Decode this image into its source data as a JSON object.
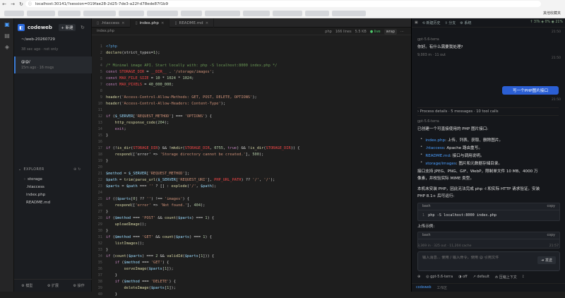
{
  "browser": {
    "url": "localhost:30141/?session=019fae28-2d25-7de3-a22f-d78ede87f1b9",
    "other_bookmarks": "其他收藏夹"
  },
  "sidebar": {
    "brand": "codeweb",
    "new_label": "+ 新建",
    "workspace": "~/web-20260729",
    "workspace_sub": "38 sec ago · not only",
    "session": {
      "title": "@@/",
      "meta": "15m ago · 16 msgs"
    },
    "explorer_title": "EXPLORER",
    "tree": [
      {
        "name": "storage",
        "type": "folder"
      },
      {
        "name": ".htaccess",
        "type": "file"
      },
      {
        "name": "index.php",
        "type": "file"
      },
      {
        "name": "README.md",
        "type": "file"
      }
    ],
    "footer": [
      "⚙ 模型",
      "⚙ 扩展",
      "⚙ 操作"
    ]
  },
  "editor": {
    "tabs": [
      {
        "label": ".htaccess",
        "active": false
      },
      {
        "label": "index.php",
        "active": true
      },
      {
        "label": "README.md",
        "active": false
      }
    ],
    "path": "index.php",
    "lang": "php",
    "lines_count": "166 lines",
    "size": "5.5 KB",
    "live": "● live",
    "wrap": "wrap"
  },
  "code": [
    [
      [
        "tg",
        "<?php"
      ]
    ],
    [
      [
        "fn",
        "declare"
      ],
      [
        "pl",
        "(strict_types="
      ],
      [
        "nm",
        "1"
      ],
      [
        "pl",
        ");"
      ]
    ],
    [],
    [
      [
        "cm",
        "/* Minimal image API. Start locally with: php -S localhost:8000 index.php */"
      ]
    ],
    [
      [
        "kw",
        "const "
      ],
      [
        "cst",
        "STORAGE_DIR"
      ],
      [
        "pl",
        " = "
      ],
      [
        "cst",
        "__DIR__"
      ],
      [
        "pl",
        " . "
      ],
      [
        "str",
        "'/storage/images'"
      ],
      [
        "pl",
        ";"
      ]
    ],
    [
      [
        "kw",
        "const "
      ],
      [
        "cst",
        "MAX_FILE_SIZE"
      ],
      [
        "pl",
        " = "
      ],
      [
        "nm",
        "10"
      ],
      [
        "pl",
        " * "
      ],
      [
        "nm",
        "1024"
      ],
      [
        "pl",
        " * "
      ],
      [
        "nm",
        "1024"
      ],
      [
        "pl",
        ";"
      ]
    ],
    [
      [
        "kw",
        "const "
      ],
      [
        "cst",
        "MAX_PIXELS"
      ],
      [
        "pl",
        " = "
      ],
      [
        "nm",
        "40_000_000"
      ],
      [
        "pl",
        ";"
      ]
    ],
    [],
    [
      [
        "fn",
        "header"
      ],
      [
        "pl",
        "("
      ],
      [
        "str",
        "'Access-Control-Allow-Methods: GET, POST, DELETE, OPTIONS'"
      ],
      [
        "pl",
        ");"
      ]
    ],
    [
      [
        "fn",
        "header"
      ],
      [
        "pl",
        "("
      ],
      [
        "str",
        "'Access-Control-Allow-Headers: Content-Type'"
      ],
      [
        "pl",
        ");"
      ]
    ],
    [],
    [
      [
        "kw",
        "if"
      ],
      [
        "pl",
        " ("
      ],
      [
        "var",
        "$_SERVER"
      ],
      [
        "pl",
        "["
      ],
      [
        "str",
        "'REQUEST_METHOD'"
      ],
      [
        "pl",
        "] === "
      ],
      [
        "str",
        "'OPTIONS'"
      ],
      [
        "pl",
        ") {"
      ]
    ],
    [
      [
        "pl",
        "    "
      ],
      [
        "fn",
        "http_response_code"
      ],
      [
        "pl",
        "("
      ],
      [
        "nm",
        "204"
      ],
      [
        "pl",
        ");"
      ]
    ],
    [
      [
        "pl",
        "    "
      ],
      [
        "kw",
        "exit"
      ],
      [
        "pl",
        ";"
      ]
    ],
    [
      [
        "pl",
        "}"
      ]
    ],
    [],
    [
      [
        "kw",
        "if"
      ],
      [
        "pl",
        " (!"
      ],
      [
        "fn",
        "is_dir"
      ],
      [
        "pl",
        "("
      ],
      [
        "cst",
        "STORAGE_DIR"
      ],
      [
        "pl",
        ") && !"
      ],
      [
        "fn",
        "mkdir"
      ],
      [
        "pl",
        "("
      ],
      [
        "cst",
        "STORAGE_DIR"
      ],
      [
        "pl",
        ", "
      ],
      [
        "nm",
        "0755"
      ],
      [
        "pl",
        ", "
      ],
      [
        "kw",
        "true"
      ],
      [
        "pl",
        ") && !"
      ],
      [
        "fn",
        "is_dir"
      ],
      [
        "pl",
        "("
      ],
      [
        "cst",
        "STORAGE_DIR"
      ],
      [
        "pl",
        ")) {"
      ]
    ],
    [
      [
        "pl",
        "    "
      ],
      [
        "fn",
        "respond"
      ],
      [
        "pl",
        "(['error' => "
      ],
      [
        "str",
        "'Storage directory cannot be created.'"
      ],
      [
        "pl",
        "], "
      ],
      [
        "nm",
        "500"
      ],
      [
        "pl",
        ");"
      ]
    ],
    [
      [
        "pl",
        "}"
      ]
    ],
    [],
    [
      [
        "var",
        "$method"
      ],
      [
        "pl",
        " = "
      ],
      [
        "var",
        "$_SERVER"
      ],
      [
        "pl",
        "["
      ],
      [
        "str",
        "'REQUEST_METHOD'"
      ],
      [
        "pl",
        "];"
      ]
    ],
    [
      [
        "var",
        "$path"
      ],
      [
        "pl",
        " = "
      ],
      [
        "fn",
        "trim"
      ],
      [
        "pl",
        "("
      ],
      [
        "fn",
        "parse_url"
      ],
      [
        "pl",
        "("
      ],
      [
        "var",
        "$_SERVER"
      ],
      [
        "pl",
        "["
      ],
      [
        "str",
        "'REQUEST_URI'"
      ],
      [
        "pl",
        "], "
      ],
      [
        "cst",
        "PHP_URL_PATH"
      ],
      [
        "pl",
        ") ?? "
      ],
      [
        "str",
        "'/'"
      ],
      [
        "pl",
        ", "
      ],
      [
        "str",
        "'/'"
      ],
      [
        "pl",
        ");"
      ]
    ],
    [
      [
        "var",
        "$parts"
      ],
      [
        "pl",
        " = "
      ],
      [
        "var",
        "$path"
      ],
      [
        "pl",
        " === "
      ],
      [
        "str",
        "''"
      ],
      [
        "pl",
        " ? [] : "
      ],
      [
        "fn",
        "explode"
      ],
      [
        "pl",
        "("
      ],
      [
        "str",
        "'/'"
      ],
      [
        "pl",
        ", "
      ],
      [
        "var",
        "$path"
      ],
      [
        "pl",
        ");"
      ]
    ],
    [],
    [
      [
        "kw",
        "if"
      ],
      [
        "pl",
        " (("
      ],
      [
        "var",
        "$parts"
      ],
      [
        "pl",
        "["
      ],
      [
        "nm",
        "0"
      ],
      [
        "pl",
        "] ?? "
      ],
      [
        "str",
        "''"
      ],
      [
        "pl",
        ") !== "
      ],
      [
        "str",
        "'images'"
      ],
      [
        "pl",
        ") {"
      ]
    ],
    [
      [
        "pl",
        "    "
      ],
      [
        "fn",
        "respond"
      ],
      [
        "pl",
        "(["
      ],
      [
        "str",
        "'error'"
      ],
      [
        "pl",
        " => "
      ],
      [
        "str",
        "'Not found.'"
      ],
      [
        "pl",
        "], "
      ],
      [
        "nm",
        "404"
      ],
      [
        "pl",
        ");"
      ]
    ],
    [
      [
        "pl",
        "}"
      ]
    ],
    [
      [
        "kw",
        "if"
      ],
      [
        "pl",
        " ("
      ],
      [
        "var",
        "$method"
      ],
      [
        "pl",
        " === "
      ],
      [
        "str",
        "'POST'"
      ],
      [
        "pl",
        " && "
      ],
      [
        "fn",
        "count"
      ],
      [
        "pl",
        "("
      ],
      [
        "var",
        "$parts"
      ],
      [
        "pl",
        ") === "
      ],
      [
        "nm",
        "1"
      ],
      [
        "pl",
        ") {"
      ]
    ],
    [
      [
        "pl",
        "    "
      ],
      [
        "fn",
        "uploadImage"
      ],
      [
        "pl",
        "();"
      ]
    ],
    [
      [
        "pl",
        "}"
      ]
    ],
    [
      [
        "kw",
        "if"
      ],
      [
        "pl",
        " ("
      ],
      [
        "var",
        "$method"
      ],
      [
        "pl",
        " === "
      ],
      [
        "str",
        "'GET'"
      ],
      [
        "pl",
        " && "
      ],
      [
        "fn",
        "count"
      ],
      [
        "pl",
        "("
      ],
      [
        "var",
        "$parts"
      ],
      [
        "pl",
        ") === "
      ],
      [
        "nm",
        "1"
      ],
      [
        "pl",
        ") {"
      ]
    ],
    [
      [
        "pl",
        "    "
      ],
      [
        "fn",
        "listImages"
      ],
      [
        "pl",
        "();"
      ]
    ],
    [
      [
        "pl",
        "}"
      ]
    ],
    [
      [
        "kw",
        "if"
      ],
      [
        "pl",
        " ("
      ],
      [
        "fn",
        "count"
      ],
      [
        "pl",
        "("
      ],
      [
        "var",
        "$parts"
      ],
      [
        "pl",
        ") === "
      ],
      [
        "nm",
        "2"
      ],
      [
        "pl",
        " && "
      ],
      [
        "fn",
        "validId"
      ],
      [
        "pl",
        "("
      ],
      [
        "var",
        "$parts"
      ],
      [
        "pl",
        "["
      ],
      [
        "nm",
        "1"
      ],
      [
        "pl",
        "])) {"
      ]
    ],
    [
      [
        "pl",
        "    "
      ],
      [
        "kw",
        "if"
      ],
      [
        "pl",
        " ("
      ],
      [
        "var",
        "$method"
      ],
      [
        "pl",
        " === "
      ],
      [
        "str",
        "'GET'"
      ],
      [
        "pl",
        ") {"
      ]
    ],
    [
      [
        "pl",
        "        "
      ],
      [
        "fn",
        "serveImage"
      ],
      [
        "pl",
        "("
      ],
      [
        "var",
        "$parts"
      ],
      [
        "pl",
        "["
      ],
      [
        "nm",
        "1"
      ],
      [
        "pl",
        "]);"
      ]
    ],
    [
      [
        "pl",
        "    }"
      ]
    ],
    [
      [
        "pl",
        "    "
      ],
      [
        "kw",
        "if"
      ],
      [
        "pl",
        " ("
      ],
      [
        "var",
        "$method"
      ],
      [
        "pl",
        " === "
      ],
      [
        "str",
        "'DELETE'"
      ],
      [
        "pl",
        ") {"
      ]
    ],
    [
      [
        "pl",
        "        "
      ],
      [
        "fn",
        "deleteImage"
      ],
      [
        "pl",
        "("
      ],
      [
        "var",
        "$parts"
      ],
      [
        "pl",
        "["
      ],
      [
        "nm",
        "1"
      ],
      [
        "pl",
        "]);"
      ]
    ],
    [
      [
        "pl",
        "    }"
      ]
    ]
  ],
  "chat": {
    "top_items": [
      "⟲ 新建历史",
      "⇪ 分支",
      "⚙ 系统"
    ],
    "stats": "↑ 37k  ◈ 0%  ◉ 21%",
    "t1": "21:50",
    "assistant_model": "gpt-5.6-terra",
    "greeting": "你好。有什么需要我处理?",
    "greeting_meta": "9,003 m  · 11 out",
    "t2": "21:50",
    "user_msg": "写一个PHP图片接口",
    "t3": "21:50",
    "process": "›  Process details · 5 messages · 10 tool calls",
    "model2": "gpt-5.6-terra",
    "intro": "已创建一个可直接使用的 PHP 图片接口:",
    "bullets": [
      {
        "link": "index.php",
        "text": ": 上传、列表、获取、删除图片。"
      },
      {
        "link": ".htaccess",
        "text": ": Apache 路由重写。"
      },
      {
        "link": "README.md",
        "text": ": 接口与调用说明。"
      },
      {
        "link": "storage/images",
        "text": ": 图片和元数据存储目录。"
      }
    ],
    "desc1": "接口支持 JPEG、PNG、GIF、WebP，限制单文件 10 MB、4000 万",
    "desc2": "像素，并校验实际 MIME 类型。",
    "desc3": "本机未安装 PHP，因此无法完成 php -l 和实际 HTTP 请求验证。安装",
    "desc4": "PHP 8.1+ 后可运行:",
    "code1": {
      "lang": "bash",
      "copy": "copy",
      "line": "php -S localhost:8000 index.php"
    },
    "upload_label": "上传示例:",
    "code2": {
      "lang": "bash",
      "copy": "copy",
      "line": "curl -X POST http://localhost:8000/images -F \"image=@./p"
    },
    "status_left": "3,369 in  · 325 out  · 11,204 cache",
    "status_right": "21:57",
    "input_placeholder": "输入消息... 使用 / 输入命令，使用 @ 引用文件",
    "send": "➜ 发送",
    "tools": [
      "⊕",
      "◎ gpt-5.6-terra",
      "◑ off",
      "↗ default",
      "⟰ 压缩上下文",
      "⟟"
    ],
    "footer_brand": "codeweb",
    "footer_items": [
      "工作区"
    ]
  }
}
